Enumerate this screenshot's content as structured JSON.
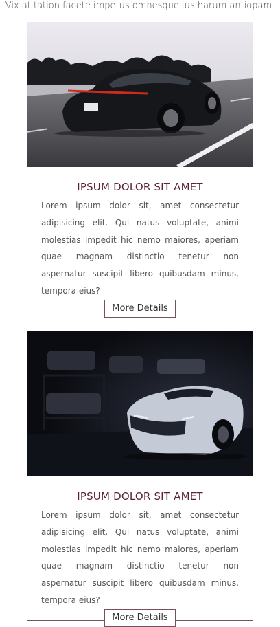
{
  "intro_text": "Vix at tation facete impetus omnesque ius harum antiopam.",
  "cards": [
    {
      "image_alt": "Black sports car driving on road",
      "title": "IPSUM DOLOR SIT AMET",
      "body": "Lorem ipsum dolor sit, amet consectetur adipisicing elit. Qui natus voluptate, animi molestias impedit hic nemo maiores, aperiam quae magnam distinctio tenetur non aspernatur suscipit libero quibusdam minus, tempora eius?",
      "button_label": "More Details"
    },
    {
      "image_alt": "Sports car in dark garage",
      "title": "IPSUM DOLOR SIT AMET",
      "body": "Lorem ipsum dolor sit, amet consectetur adipisicing elit. Qui natus voluptate, animi molestias impedit hic nemo maiores, aperiam quae magnam distinctio tenetur non aspernatur suscipit libero quibusdam minus, tempora eius?",
      "button_label": "More Details"
    }
  ],
  "colors": {
    "accent": "#5a2436",
    "border": "#7a4f5c"
  }
}
